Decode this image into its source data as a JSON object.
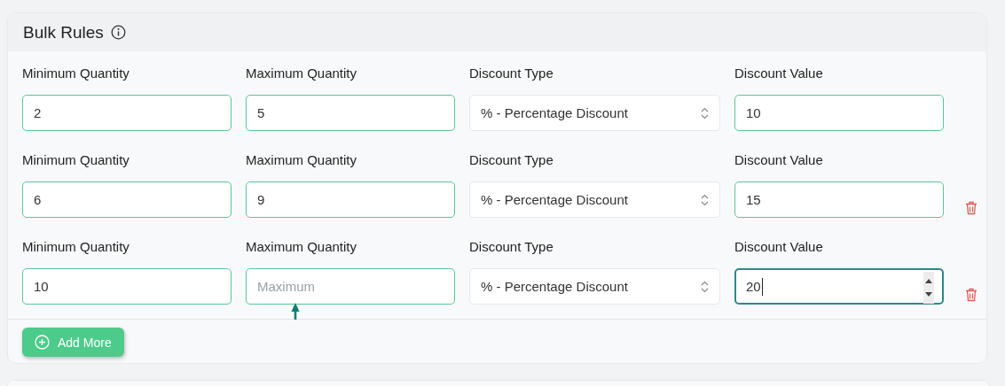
{
  "card": {
    "title": "Bulk Rules"
  },
  "rules": [
    {
      "removable": false,
      "fields": [
        {
          "kind": "input",
          "label": "Minimum Quantity",
          "value": "2"
        },
        {
          "kind": "input",
          "label": "Maximum Quantity",
          "value": "5"
        },
        {
          "kind": "select",
          "label": "Discount Type",
          "value": "% - Percentage Discount"
        },
        {
          "kind": "number",
          "label": "Discount Value",
          "value": "10",
          "focused": false
        }
      ]
    },
    {
      "removable": true,
      "fields": [
        {
          "kind": "input",
          "label": "Minimum Quantity",
          "value": "6"
        },
        {
          "kind": "input",
          "label": "Maximum Quantity",
          "value": "9"
        },
        {
          "kind": "select",
          "label": "Discount Type",
          "value": "% - Percentage Discount"
        },
        {
          "kind": "number",
          "label": "Discount Value",
          "value": "15",
          "focused": false
        }
      ]
    },
    {
      "removable": true,
      "fields": [
        {
          "kind": "input",
          "label": "Minimum Quantity",
          "value": "10"
        },
        {
          "kind": "input",
          "label": "Maximum Quantity",
          "placeholder": "Maximum"
        },
        {
          "kind": "select",
          "label": "Discount Type",
          "value": "% - Percentage Discount"
        },
        {
          "kind": "number",
          "label": "Discount Value",
          "value": "20",
          "focused": true
        }
      ]
    }
  ],
  "add_button": {
    "label": "Add More"
  }
}
